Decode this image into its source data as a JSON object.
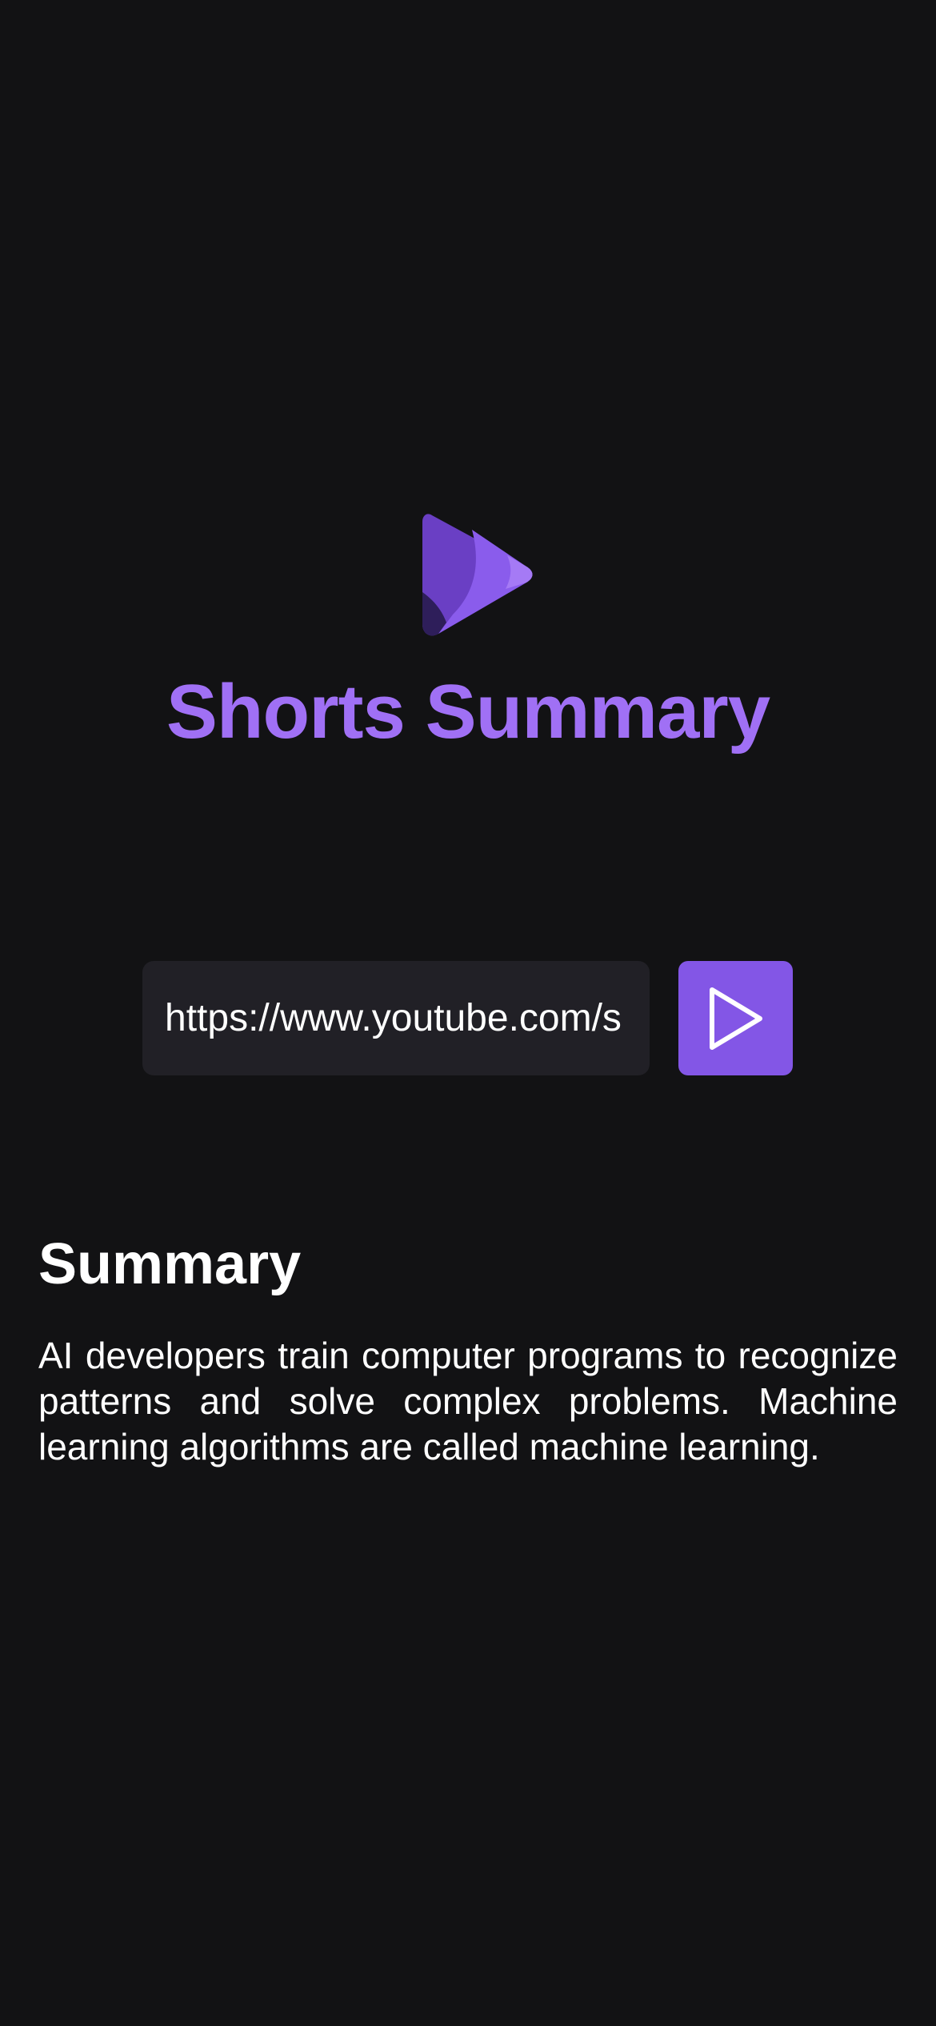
{
  "app": {
    "title": "Shorts Summary",
    "logo_icon": "play-logo-icon",
    "accent_color": "#a070f5",
    "button_color": "#8356e6",
    "background_color": "#121214"
  },
  "search": {
    "value": "https://www.youtube.com/s",
    "submit_icon": "play-icon"
  },
  "summary": {
    "heading": "Summary",
    "text": "AI developers train computer programs to recognize patterns and solve complex problems. Machine learning algorithms are called machine learning."
  }
}
